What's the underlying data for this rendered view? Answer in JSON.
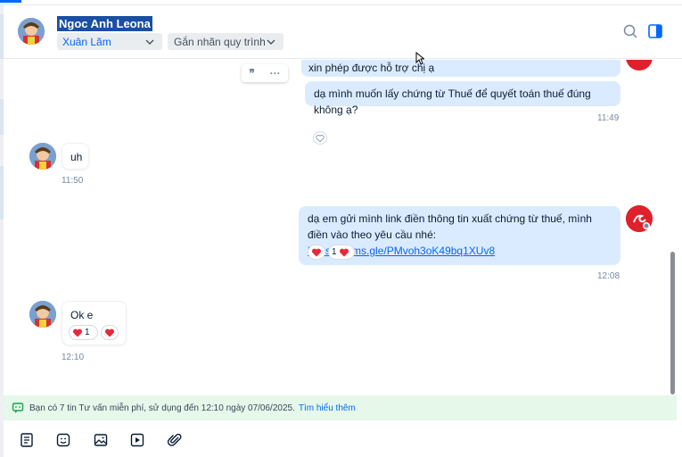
{
  "header": {
    "contact_name": "Ngoc Anh Leona",
    "assignee": "Xuân Lãm",
    "tag_label": "Gắn nhãn quy trình",
    "icons": [
      "search-icon",
      "side-panel-icon"
    ]
  },
  "messages": {
    "m1_partial": "xin phép được hỗ trợ chị ạ",
    "m1_text": "dạ mình muốn lấy chứng từ Thuế để quyết toán thuế đúng không ạ?",
    "m1_time": "11:49",
    "m2_text": "uh",
    "m2_time": "11:50",
    "m3_text": "dạ em gửi mình link điền thông tin xuất chứng từ thuế, mình điền vào theo yêu cầu nhé:",
    "m3_link": "https://forms.gle/PMvoh3oK49bq1XUv8",
    "m3_reaction_count": "1",
    "m3_time": "12:08",
    "m4_text": "Ok e",
    "m4_reaction_count": "1",
    "m4_time": "12:10"
  },
  "quote_tools": {
    "quote_glyph": "❞",
    "more_glyph": "···"
  },
  "banner": {
    "text": "Bạn có 7 tin Tư vấn miễn phí, sử dụng đến 12:10 ngày 07/06/2025.",
    "link": "Tìm hiểu thêm"
  },
  "toolbar": {
    "icons": [
      "message-template-icon",
      "sticker-icon",
      "image-icon",
      "video-icon",
      "attachment-icon"
    ]
  },
  "colors": {
    "accent": "#0068ff",
    "outgoing_bubble": "#dbebff",
    "banner_bg": "#e5f8ea",
    "heart": "#e8283b"
  }
}
